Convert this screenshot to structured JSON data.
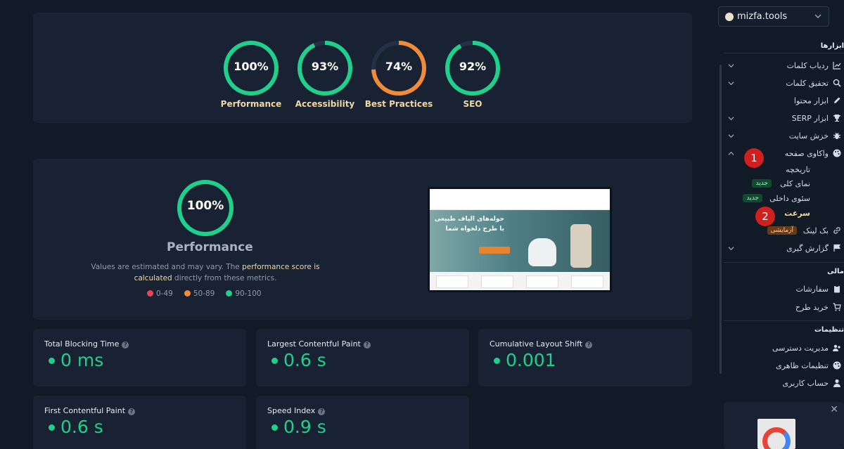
{
  "scores": [
    {
      "label": "Performance",
      "pct_text": "100%",
      "value": 100,
      "color": "#1fd08c"
    },
    {
      "label": "Accessibility",
      "pct_text": "93%",
      "value": 93,
      "color": "#1fd08c"
    },
    {
      "label": "Best Practices",
      "pct_text": "74%",
      "value": 74,
      "color": "#f08b3a"
    },
    {
      "label": "SEO",
      "pct_text": "92%",
      "value": 92,
      "color": "#1fd08c"
    }
  ],
  "performance": {
    "pct_text": "100%",
    "value": 100,
    "title": "Performance",
    "desc_before": "Values are estimated and may vary. The ",
    "desc_link": "performance score is calculated",
    "desc_after": " directly from these metrics.",
    "legend": [
      {
        "label": "0-49",
        "color": "#e8445a"
      },
      {
        "label": "50-89",
        "color": "#f08b3a"
      },
      {
        "label": "90-100",
        "color": "#1fd08c"
      }
    ]
  },
  "metrics": [
    {
      "name": "Total Blocking Time",
      "value": "0 ms"
    },
    {
      "name": "Largest Contentful Paint",
      "value": "0.6 s"
    },
    {
      "name": "Cumulative Layout Shift",
      "value": "0.001"
    },
    {
      "name": "First Contentful Paint",
      "value": "0.6 s"
    },
    {
      "name": "Speed Index",
      "value": "0.9 s"
    }
  ],
  "sidebar": {
    "site": "mizfa.tools",
    "tools_heading": "ابزارها",
    "tools": [
      {
        "label": "ردیاب کلمات",
        "icon": "chart-icon",
        "expandable": true
      },
      {
        "label": "تحقیق کلمات",
        "icon": "search-icon",
        "expandable": true
      },
      {
        "label": "ابزار محتوا",
        "icon": "pencil-icon",
        "expandable": false
      },
      {
        "label": "ابزار SERP",
        "icon": "trophy-icon",
        "expandable": true
      },
      {
        "label": "خزش سایت",
        "icon": "bug-icon",
        "expandable": true
      },
      {
        "label": "واکاوی صفحه",
        "icon": "palette-icon",
        "expandable": true
      }
    ],
    "subitems": [
      {
        "label": "تاریخچه",
        "badge": ""
      },
      {
        "label": "نمای کلی",
        "badge": "جدید"
      },
      {
        "label": "سئوی داخلی",
        "badge": "جدید"
      },
      {
        "label": "سرعت",
        "badge": ""
      }
    ],
    "backlink": {
      "label": "بک لینک",
      "badge": "آزمایشی",
      "icon": "link-icon"
    },
    "reports": {
      "label": "گزارش گیری",
      "icon": "flag-icon"
    },
    "finance_heading": "مالی",
    "finance": [
      {
        "label": "سفارشات",
        "icon": "clipboard-icon"
      },
      {
        "label": "خرید طرح",
        "icon": "cart-icon"
      }
    ],
    "settings_heading": "تنظیمات",
    "settings": [
      {
        "label": "مدیریت دسترسی",
        "icon": "users-icon"
      },
      {
        "label": "تنظیمات ظاهری",
        "icon": "palette-icon"
      },
      {
        "label": "حساب کاربری",
        "icon": "user-icon"
      }
    ],
    "markers": [
      "1",
      "2"
    ],
    "promo_close": "✕"
  },
  "screenshot": {
    "hero_line1": "حوله‌های الیاف طبیعی",
    "hero_line2": "با طرح دلخواه شما"
  }
}
